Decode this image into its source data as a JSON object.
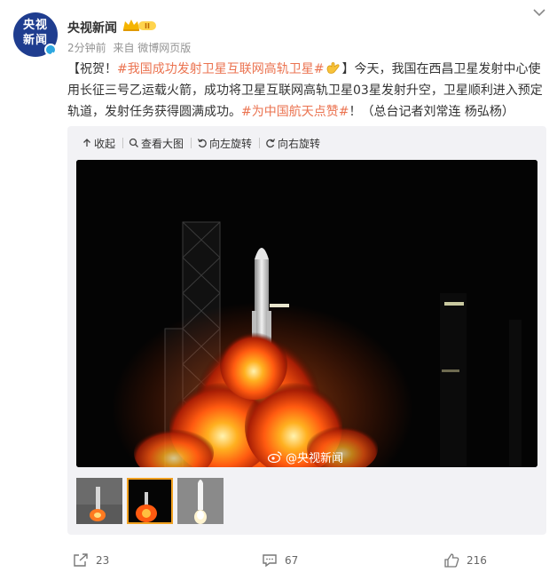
{
  "post": {
    "author": "央视新闻",
    "avatar_text_top": "央视",
    "avatar_text_bottom": "新闻",
    "vip_badge": "II",
    "time": "2分钟前",
    "source": "来自 微博网页版",
    "text_parts": {
      "open_bracket": "【祝贺！",
      "hashtag1": "#我国成功发射卫星互联网高轨卫星#",
      "close_and_body": "】今天，我国在西昌卫星发射中心使用长征三号乙运载火箭，成功将卫星互联网高轨卫星03星发射升空，卫星顺利进入预定轨道，发射任务获得圆满成功。",
      "hashtag2": "#为中国航天点赞#",
      "tail": "！（总台记者刘常连 杨弘杨）"
    }
  },
  "toolbar": {
    "collapse_label": "收起",
    "view_large_label": "查看大图",
    "rotate_left_label": "向左旋转",
    "rotate_right_label": "向右旋转"
  },
  "photo": {
    "watermark": "@央视新闻"
  },
  "footer": {
    "reposts": "23",
    "comments": "67",
    "likes": "216"
  },
  "colors": {
    "hashtag": "#eb7350",
    "accent_orange": "#f0a020",
    "avatar_blue": "#1f3d8f"
  },
  "icons": [
    "crown-icon",
    "chevron-down-icon",
    "collapse-arrow-icon",
    "magnifier-icon",
    "rotate-left-icon",
    "rotate-right-icon",
    "weibo-logo-icon",
    "repost-icon",
    "comment-icon",
    "like-icon",
    "waving-hand-icon"
  ]
}
